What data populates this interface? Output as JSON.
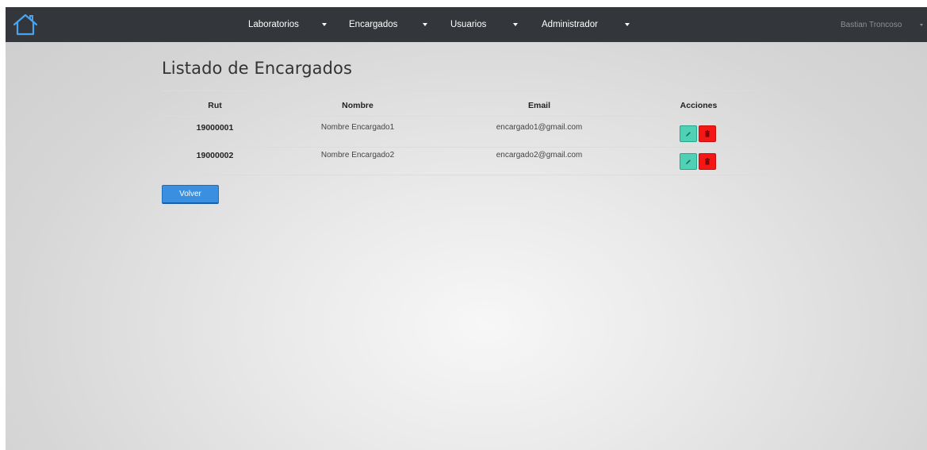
{
  "navbar": {
    "items": [
      {
        "label": "Laboratorios"
      },
      {
        "label": "Encargados"
      },
      {
        "label": "Usuarios"
      },
      {
        "label": "Administrador"
      }
    ],
    "user": "Bastian Troncoso"
  },
  "page": {
    "title": "Listado de Encargados",
    "back_label": "Volver"
  },
  "table": {
    "headers": {
      "rut": "Rut",
      "nombre": "Nombre",
      "email": "Email",
      "acciones": "Acciones"
    },
    "rows": [
      {
        "rut": "19000001",
        "nombre": "Nombre Encargado1",
        "email": "encargado1@gmail.com"
      },
      {
        "rut": "19000002",
        "nombre": "Nombre Encargado2",
        "email": "encargado2@gmail.com"
      }
    ]
  },
  "colors": {
    "navbar": "#33363a",
    "edit_button": "#4fd1b6",
    "delete_button": "#f51616",
    "primary_button": "#3b8fe0"
  },
  "icons": {
    "home": "home-icon",
    "edit": "pencil-icon",
    "delete": "trash-icon",
    "dropdown": "caret-down-icon"
  }
}
